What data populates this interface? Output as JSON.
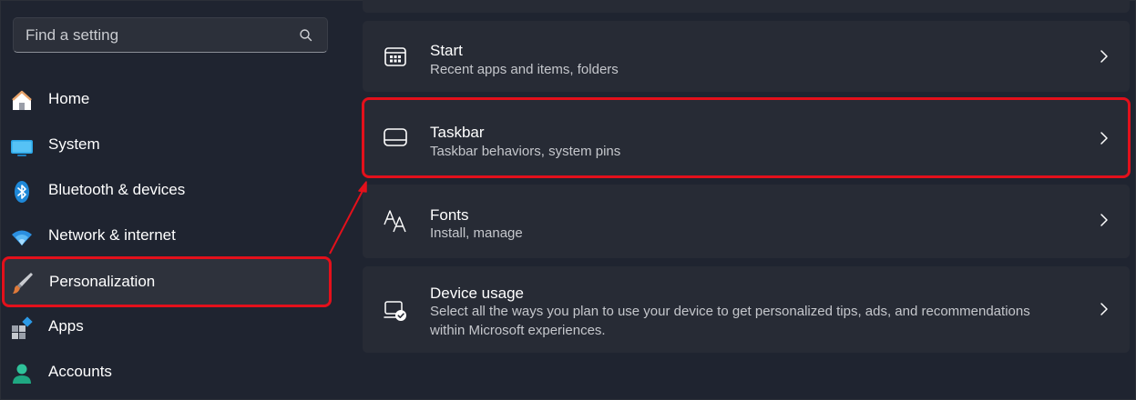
{
  "search": {
    "placeholder": "Find a setting",
    "icon": "search-icon"
  },
  "sidebar": {
    "items": [
      {
        "label": "Home",
        "icon": "home-icon"
      },
      {
        "label": "System",
        "icon": "monitor-icon"
      },
      {
        "label": "Bluetooth & devices",
        "icon": "bluetooth-icon"
      },
      {
        "label": "Network & internet",
        "icon": "wifi-icon"
      },
      {
        "label": "Personalization",
        "icon": "brush-icon",
        "selected": true
      },
      {
        "label": "Apps",
        "icon": "apps-icon"
      },
      {
        "label": "Accounts",
        "icon": "person-icon"
      }
    ]
  },
  "main": {
    "cards": [
      {
        "title": "Start",
        "description": "Recent apps and items, folders",
        "icon": "start-icon"
      },
      {
        "title": "Taskbar",
        "description": "Taskbar behaviors, system pins",
        "icon": "taskbar-icon",
        "highlighted": true
      },
      {
        "title": "Fonts",
        "description": "Install, manage",
        "icon": "fonts-icon"
      },
      {
        "title": "Device usage",
        "description_line1": "Select all the ways you plan to use your device to get personalized tips, ads, and recommendations",
        "description_line2": "within Microsoft experiences.",
        "icon": "device-usage-icon"
      }
    ]
  },
  "colors": {
    "background": "#1f2430",
    "card": "#272b35",
    "highlight": "#e3101b",
    "accent": "#4fb5f0"
  }
}
